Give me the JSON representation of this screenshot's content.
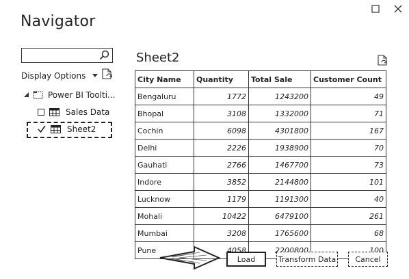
{
  "window": {
    "title": "Navigator",
    "maximize_icon": "maximize-icon",
    "close_icon": "close-icon"
  },
  "left_panel": {
    "search": {
      "value": "",
      "placeholder": "",
      "icon": "search-icon"
    },
    "display_options": {
      "label": "Display Options",
      "icon": "caret-down-icon"
    },
    "refresh_icon": "refresh-icon",
    "tree": {
      "root": {
        "label": "Power BI Toolti...",
        "icon": "folder-icon"
      },
      "items": [
        {
          "label": "Sales Data",
          "checked": false,
          "icon": "table-icon"
        },
        {
          "label": "Sheet2",
          "checked": true,
          "icon": "table-icon",
          "selected": true
        }
      ]
    }
  },
  "preview": {
    "title": "Sheet2",
    "refresh_icon": "refresh-icon",
    "columns": [
      "City Name",
      "Quantity",
      "Total Sale",
      "Customer Count"
    ],
    "rows": [
      [
        "Bengaluru",
        "1772",
        "1243200",
        "49"
      ],
      [
        "Bhopal",
        "3108",
        "1332000",
        "71"
      ],
      [
        "Cochin",
        "6098",
        "4301800",
        "167"
      ],
      [
        "Delhi",
        "2226",
        "1938900",
        "70"
      ],
      [
        "Gauhati",
        "2766",
        "1467700",
        "73"
      ],
      [
        "Indore",
        "3852",
        "2144800",
        "101"
      ],
      [
        "Lucknow",
        "1179",
        "1191300",
        "40"
      ],
      [
        "Mohali",
        "10422",
        "6479100",
        "261"
      ],
      [
        "Mumbai",
        "3208",
        "1765600",
        "68"
      ],
      [
        "Pune",
        "4058",
        "2200800",
        "100"
      ]
    ]
  },
  "footer": {
    "load": "Load",
    "transform": "Transform Data",
    "cancel": "Cancel",
    "arrow_icon": "pointing-arrow-icon"
  }
}
